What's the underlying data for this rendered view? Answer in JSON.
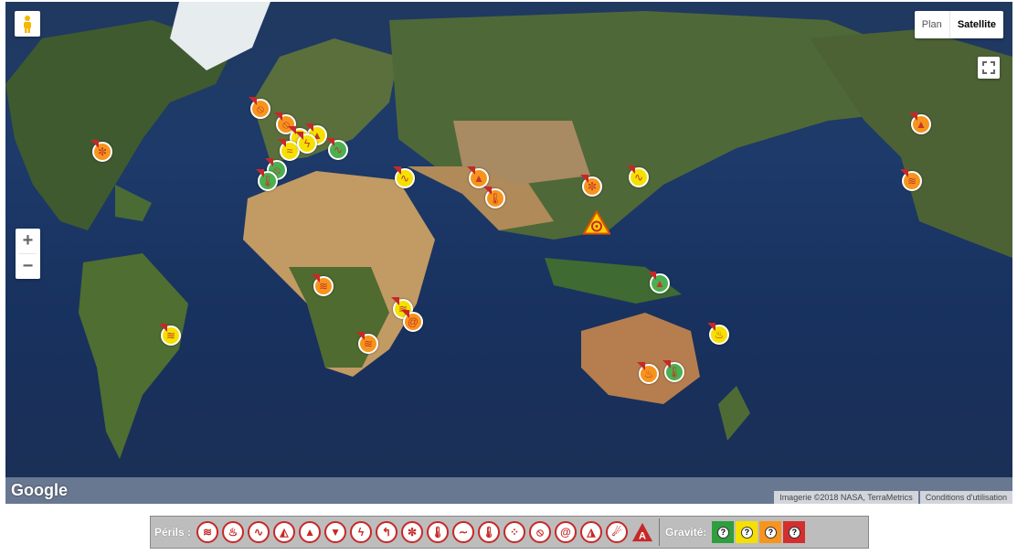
{
  "map": {
    "map_type_options": [
      {
        "label": "Plan",
        "active": false
      },
      {
        "label": "Satellite",
        "active": true
      }
    ],
    "zoom_in": "+",
    "zoom_out": "−",
    "logo": "Google",
    "attribution": "Imagerie ©2018 NASA, TerraMetrics",
    "terms": "Conditions d'utilisation",
    "colors": {
      "green": "#4caf50",
      "yellow": "#f5e000",
      "orange": "#f7941d",
      "red": "#d32f2f",
      "ocean": "#1d3a6a"
    }
  },
  "markers": [
    {
      "name": "marker-north-america-east",
      "icon": "snowflake-icon",
      "glyph": "✼",
      "severity": "orange"
    },
    {
      "name": "marker-uk",
      "icon": "rain-icon",
      "glyph": "⦸",
      "severity": "orange"
    },
    {
      "name": "marker-benelux",
      "icon": "rain-icon",
      "glyph": "⦸",
      "severity": "orange"
    },
    {
      "name": "marker-germany",
      "icon": "landslide-icon",
      "glyph": "▲",
      "severity": "yellow"
    },
    {
      "name": "marker-france-1",
      "icon": "thunder-icon",
      "glyph": "⚡",
      "severity": "yellow"
    },
    {
      "name": "marker-france-2",
      "icon": "wind-icon",
      "glyph": "≈",
      "severity": "yellow"
    },
    {
      "name": "marker-italy",
      "icon": "storm-icon",
      "glyph": "ϟ",
      "severity": "yellow"
    },
    {
      "name": "marker-balkans",
      "icon": "earthquake-icon",
      "glyph": "∿",
      "severity": "green"
    },
    {
      "name": "marker-iberia-1",
      "icon": "rain-icon",
      "glyph": "⦸",
      "severity": "green"
    },
    {
      "name": "marker-iberia-2",
      "icon": "heat-icon",
      "glyph": "🌡",
      "severity": "green"
    },
    {
      "name": "marker-caucasus",
      "icon": "earthquake-icon",
      "glyph": "∿",
      "severity": "yellow"
    },
    {
      "name": "marker-central-asia",
      "icon": "landslide-icon",
      "glyph": "▲",
      "severity": "orange"
    },
    {
      "name": "marker-himalaya",
      "icon": "heat-icon",
      "glyph": "🌡",
      "severity": "orange"
    },
    {
      "name": "marker-east-china",
      "icon": "snowflake-icon",
      "glyph": "✼",
      "severity": "orange"
    },
    {
      "name": "marker-japan",
      "icon": "earthquake-icon",
      "glyph": "∿",
      "severity": "yellow"
    },
    {
      "name": "marker-west-africa",
      "icon": "flood-icon",
      "glyph": "≋",
      "severity": "orange"
    },
    {
      "name": "marker-east-africa",
      "icon": "flood-icon",
      "glyph": "≋",
      "severity": "yellow"
    },
    {
      "name": "marker-madagascar-1",
      "icon": "cyclone-icon",
      "glyph": "@",
      "severity": "orange"
    },
    {
      "name": "marker-mozambique",
      "icon": "flood-icon",
      "glyph": "≋",
      "severity": "orange"
    },
    {
      "name": "marker-brazil",
      "icon": "flood-icon",
      "glyph": "≋",
      "severity": "yellow"
    },
    {
      "name": "marker-new-guinea",
      "icon": "volcano-icon",
      "glyph": "▲",
      "severity": "green"
    },
    {
      "name": "marker-vanuatu",
      "icon": "fire-icon",
      "glyph": "♨",
      "severity": "yellow"
    },
    {
      "name": "marker-australia-1",
      "icon": "fire-icon",
      "glyph": "♨",
      "severity": "orange"
    },
    {
      "name": "marker-australia-2",
      "icon": "heat-icon",
      "glyph": "🌡",
      "severity": "green"
    },
    {
      "name": "marker-alaska",
      "icon": "landslide-icon",
      "glyph": "▲",
      "severity": "orange"
    },
    {
      "name": "marker-us-west",
      "icon": "flood-icon",
      "glyph": "≋",
      "severity": "orange"
    }
  ],
  "cyclone_alert": {
    "icon": "cyclone-warning-icon",
    "glyph": "@"
  },
  "legend": {
    "perils_label": "Périls :",
    "perils": [
      {
        "icon": "flood-icon",
        "glyph": "≋"
      },
      {
        "icon": "fire-icon",
        "glyph": "♨"
      },
      {
        "icon": "earthquake-icon",
        "glyph": "∿"
      },
      {
        "icon": "landslide-icon",
        "glyph": "◭"
      },
      {
        "icon": "volcano-icon",
        "glyph": "▲"
      },
      {
        "icon": "tornado-icon",
        "glyph": "▼"
      },
      {
        "icon": "lightning-icon",
        "glyph": "ϟ"
      },
      {
        "icon": "wind-icon",
        "glyph": "↰"
      },
      {
        "icon": "snowflake-icon",
        "glyph": "✼"
      },
      {
        "icon": "heat-icon",
        "glyph": "🌡"
      },
      {
        "icon": "wave-icon",
        "glyph": "∼"
      },
      {
        "icon": "cold-icon",
        "glyph": "🌡"
      },
      {
        "icon": "hail-icon",
        "glyph": "⁘"
      },
      {
        "icon": "rain-icon",
        "glyph": "⦸"
      },
      {
        "icon": "cyclone-icon",
        "glyph": "@"
      },
      {
        "icon": "mountain-icon",
        "glyph": "◮"
      },
      {
        "icon": "meteor-icon",
        "glyph": "☄"
      }
    ],
    "alert_glyph": "A",
    "severity_label": "Gravité:",
    "severities": [
      {
        "name": "severity-green",
        "color": "#2e9e3e",
        "glyph": "?"
      },
      {
        "name": "severity-yellow",
        "color": "#f5e000",
        "glyph": "?"
      },
      {
        "name": "severity-orange",
        "color": "#f7941d",
        "glyph": "?"
      },
      {
        "name": "severity-red",
        "color": "#d32f2f",
        "glyph": "?"
      }
    ]
  }
}
